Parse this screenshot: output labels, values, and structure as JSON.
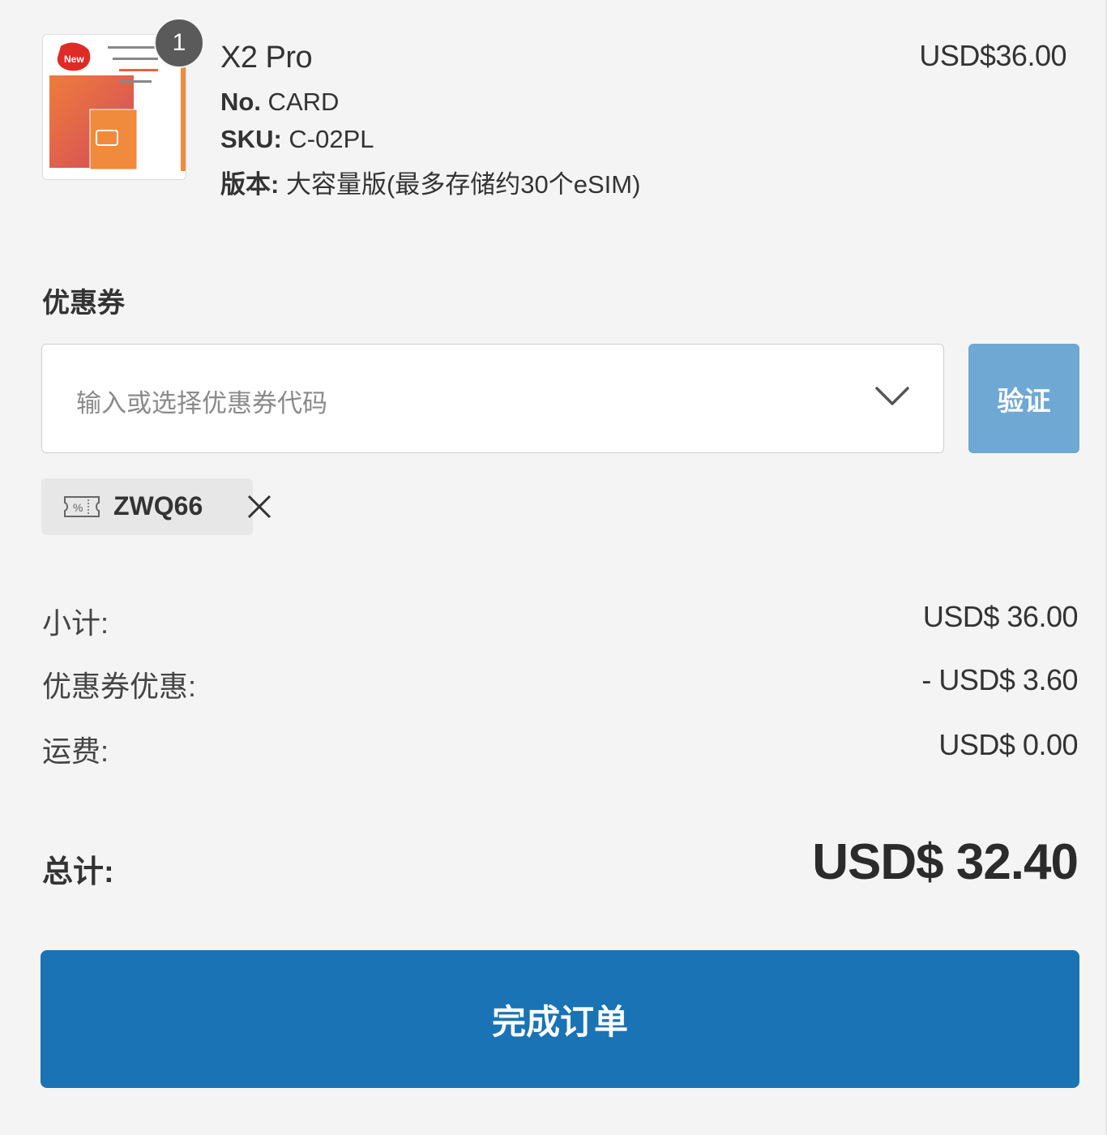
{
  "product": {
    "quantity": "1",
    "name": "X2 Pro",
    "price": "USD$36.00",
    "no_label": "No.",
    "no_value": " CARD",
    "sku_label": "SKU:",
    "sku_value": " C-02PL",
    "version_label": "版本:",
    "version_value": " 大容量版(最多存储约30个eSIM)",
    "thumb_badge": "New"
  },
  "coupon": {
    "heading": "优惠券",
    "placeholder": "输入或选择优惠券代码",
    "verify_label": "验证",
    "applied_code": "ZWQ66"
  },
  "totals": {
    "subtotal_label": "小计:",
    "subtotal_value": "USD$ 36.00",
    "discount_label": "优惠券优惠:",
    "discount_value": "- USD$ 3.60",
    "shipping_label": "运费:",
    "shipping_value": "USD$ 0.00",
    "total_label": "总计:",
    "total_value": "USD$ 32.40"
  },
  "actions": {
    "complete_label": "完成订单"
  },
  "colors": {
    "primary": "#1a73b4",
    "verify_disabled": "#6fa8d3",
    "background": "#f4f4f4"
  },
  "icons": {
    "coupon_tag": "coupon-ticket-icon",
    "remove": "close-icon",
    "dropdown": "chevron-down-icon"
  }
}
